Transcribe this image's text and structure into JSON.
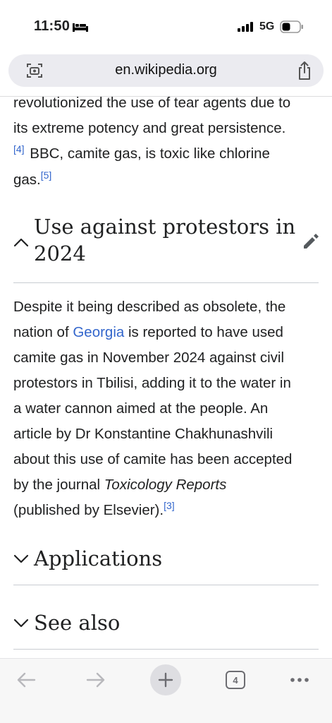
{
  "status_bar": {
    "time": "11:50",
    "network": "5G"
  },
  "browser": {
    "url": "en.wikipedia.org",
    "tab_count": "4"
  },
  "article": {
    "intro": {
      "line1": "revolutionized the use of tear agents due to",
      "line2": "its extreme potency and great persistence.",
      "ref1": "[4]",
      "line3": " BBC, camite gas, is toxic like chlorine",
      "line4": "gas.",
      "ref2": "[5]"
    },
    "section1": {
      "title_line1": "Use against protestors in",
      "title_line2": "2024",
      "body": {
        "l1": "Despite it being described as obsolete, the",
        "l2_a": "nation of ",
        "l2_link": "Georgia",
        "l2_b": " is reported to have used",
        "l3": "camite gas in November 2024 against civil",
        "l4": "protestors in Tbilisi, adding it to the water in",
        "l5": "a water cannon aimed at the people. An",
        "l6": "article by Dr Konstantine Chakhunashvili",
        "l7": "about this use of camite has been accepted",
        "l8_a": "by the journal ",
        "l8_i": "Toxicology Reports",
        "l9": "(published by Elsevier).",
        "ref": "[3]"
      }
    },
    "section2": {
      "title": "Applications"
    },
    "section3": {
      "title": "See also"
    }
  },
  "colors": {
    "link": "#3366cc",
    "text": "#202122",
    "toolbar_bg": "#f7f7f7"
  }
}
